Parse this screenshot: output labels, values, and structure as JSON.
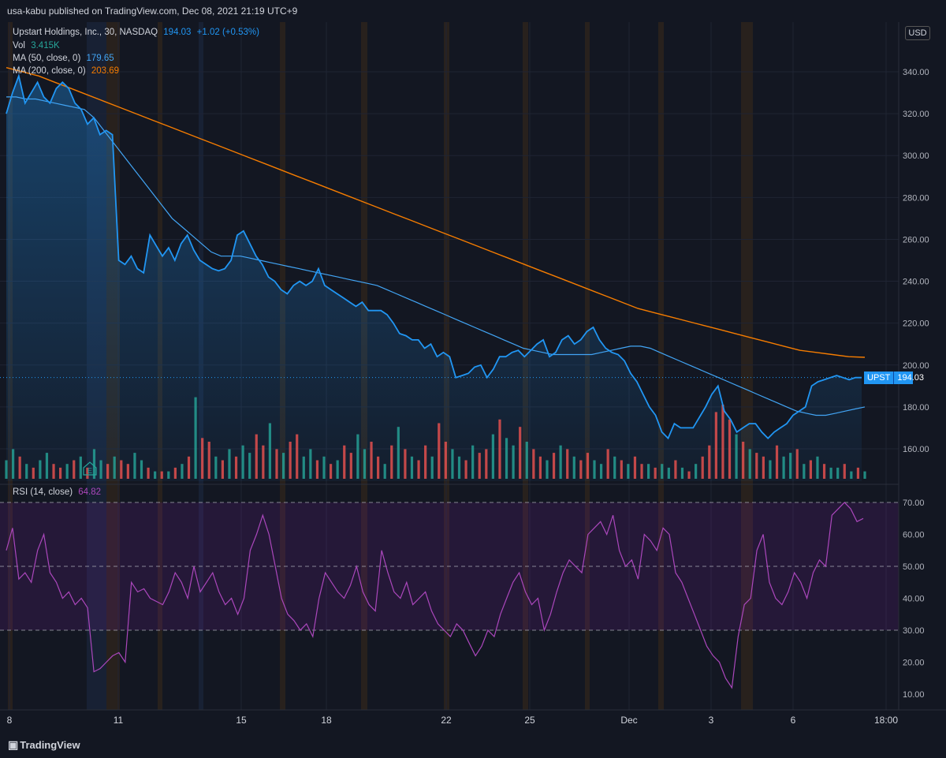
{
  "header": {
    "published": "usa-kabu published on TradingView.com, Dec 08, 2021 21:19 UTC+9"
  },
  "legend": {
    "symbol": "Upstart Holdings, Inc., 30, NASDAQ",
    "last": "194.03",
    "change": "+1.02 (+0.53%)",
    "vol_label": "Vol",
    "vol_value": "3.415K",
    "ma50_label": "MA (50, close, 0)",
    "ma50_value": "179.65",
    "ma200_label": "MA (200, close, 0)",
    "ma200_value": "203.69",
    "rsi_label": "RSI (14, close)",
    "rsi_value": "64.82"
  },
  "currency": "USD",
  "price_tag": {
    "ticker": "UPST",
    "value": "194.03"
  },
  "earnings_marker": "E",
  "footer": {
    "brand": "TradingView"
  },
  "colors": {
    "price": "#2196f3",
    "ma50": "#42a5f5",
    "ma200": "#f57c00",
    "rsi": "#9c27b0",
    "vol_up": "#26a69a",
    "vol_down": "#ef5350"
  },
  "chart_data": [
    {
      "type": "line",
      "name": "price",
      "x_ticks": [
        "8",
        "11",
        "15",
        "18",
        "22",
        "25",
        "Dec",
        "3",
        "6",
        "18:00"
      ],
      "y_ticks": [
        "340.00",
        "320.00",
        "300.00",
        "280.00",
        "260.00",
        "240.00",
        "220.00",
        "200.00",
        "180.00",
        "160.00"
      ],
      "ylim": [
        145,
        345
      ],
      "series": [
        {
          "name": "Upstart Holdings, Inc.",
          "values": [
            320,
            330,
            338,
            325,
            330,
            335,
            328,
            325,
            332,
            335,
            332,
            325,
            322,
            315,
            318,
            310,
            312,
            310,
            250,
            248,
            252,
            246,
            244,
            262,
            257,
            252,
            256,
            250,
            258,
            262,
            255,
            250,
            248,
            246,
            245,
            246,
            250,
            262,
            264,
            258,
            252,
            248,
            242,
            240,
            236,
            234,
            238,
            240,
            238,
            240,
            246,
            238,
            236,
            234,
            232,
            230,
            228,
            230,
            226,
            226,
            226,
            224,
            220,
            215,
            214,
            212,
            212,
            208,
            210,
            204,
            206,
            204,
            194,
            195,
            196,
            199,
            200,
            194,
            198,
            204,
            204,
            206,
            207,
            204,
            207,
            210,
            212,
            204,
            206,
            212,
            214,
            210,
            212,
            216,
            218,
            212,
            208,
            206,
            205,
            202,
            196,
            192,
            186,
            180,
            176,
            168,
            165,
            172,
            170,
            170,
            170,
            175,
            180,
            186,
            190,
            178,
            174,
            168,
            170,
            172,
            172,
            168,
            165,
            168,
            170,
            172,
            176,
            178,
            180,
            190,
            192,
            193,
            194,
            195,
            194,
            193,
            194,
            194
          ]
        },
        {
          "name": "MA (50, close, 0)",
          "values": [
            328,
            328,
            327,
            327,
            326,
            325,
            324,
            323,
            322,
            318,
            312,
            306,
            300,
            294,
            288,
            282,
            276,
            270,
            266,
            262,
            258,
            254,
            252,
            252,
            252,
            251,
            250,
            249,
            248,
            247,
            246,
            245,
            244,
            243,
            242,
            241,
            240,
            239,
            238,
            236,
            234,
            232,
            230,
            228,
            226,
            224,
            222,
            220,
            218,
            216,
            214,
            212,
            210,
            208,
            207,
            206,
            205,
            205,
            205,
            205,
            205,
            206,
            207,
            208,
            209,
            209,
            208,
            206,
            204,
            202,
            200,
            198,
            196,
            194,
            192,
            190,
            188,
            186,
            184,
            182,
            180,
            178,
            177,
            176,
            176,
            177,
            178,
            179,
            180
          ]
        },
        {
          "name": "MA (200, close, 0)",
          "values": [
            342,
            340,
            338,
            335,
            332,
            329,
            326,
            323,
            320,
            317,
            314,
            311,
            308,
            305,
            302,
            299,
            296,
            293,
            290,
            287,
            284,
            281,
            278,
            275,
            272,
            269,
            266,
            263,
            260,
            257,
            254,
            251,
            248,
            245,
            242,
            239,
            236,
            233,
            230,
            227,
            225,
            223,
            221,
            219,
            217,
            215,
            213,
            211,
            209,
            207,
            206,
            205,
            204,
            203.69
          ]
        }
      ]
    },
    {
      "type": "bar",
      "name": "volume",
      "values": [
        5,
        8,
        6,
        4,
        3,
        5,
        7,
        4,
        3,
        4,
        5,
        6,
        3,
        8,
        5,
        4,
        6,
        5,
        4,
        7,
        5,
        3,
        2,
        2,
        2,
        3,
        4,
        6,
        22,
        11,
        10,
        6,
        5,
        8,
        6,
        9,
        7,
        12,
        9,
        15,
        8,
        7,
        10,
        12,
        6,
        8,
        5,
        6,
        4,
        5,
        9,
        7,
        12,
        8,
        10,
        6,
        4,
        9,
        14,
        8,
        6,
        5,
        9,
        6,
        15,
        10,
        8,
        6,
        5,
        9,
        7,
        8,
        12,
        16,
        11,
        9,
        14,
        10,
        8,
        6,
        5,
        7,
        9,
        8,
        6,
        5,
        7,
        5,
        4,
        8,
        6,
        5,
        4,
        6,
        4,
        4,
        3,
        4,
        3,
        5,
        3,
        2,
        4,
        6,
        9,
        18,
        20,
        16,
        12,
        10,
        8,
        7,
        6,
        5,
        9,
        6,
        7,
        8,
        4,
        5,
        6,
        4,
        3,
        3,
        4,
        2,
        3,
        2
      ],
      "colors_up": [
        1,
        1,
        0,
        1,
        0,
        1,
        1,
        0,
        0,
        1,
        0,
        1,
        0,
        1,
        1,
        0,
        1,
        0,
        0,
        1,
        1,
        0,
        1,
        0,
        1,
        0,
        1,
        0,
        1,
        0,
        0,
        1,
        0,
        1,
        0,
        1,
        1,
        0,
        0,
        1,
        0,
        1,
        0,
        0,
        1,
        1,
        0,
        1,
        0,
        1,
        0,
        0,
        1,
        1,
        0,
        0,
        1,
        0,
        1,
        0,
        1,
        0,
        0,
        1,
        0,
        0,
        1,
        1,
        0,
        1,
        0,
        0,
        1,
        0,
        1,
        1,
        0,
        1,
        0,
        0,
        1,
        0,
        1,
        0,
        1,
        0,
        0,
        1,
        1,
        0,
        1,
        0,
        1,
        0,
        0,
        1,
        0,
        1,
        1,
        0,
        1,
        0,
        1,
        0,
        0,
        0,
        0,
        0,
        1,
        0,
        1,
        0,
        0,
        1,
        0,
        1,
        1,
        0,
        1,
        0,
        1,
        0,
        1,
        1,
        0,
        1,
        0,
        1
      ]
    },
    {
      "type": "line",
      "name": "RSI (14, close)",
      "y_ticks": [
        "70.00",
        "60.00",
        "50.00",
        "40.00",
        "30.00",
        "20.00",
        "10.00"
      ],
      "ylim": [
        5,
        75
      ],
      "bands": [
        30,
        50,
        70
      ],
      "values": [
        55,
        62,
        46,
        48,
        45,
        55,
        60,
        48,
        45,
        40,
        42,
        38,
        40,
        37,
        17,
        18,
        20,
        22,
        23,
        20,
        45,
        42,
        43,
        40,
        39,
        38,
        42,
        48,
        45,
        40,
        50,
        42,
        45,
        48,
        42,
        38,
        40,
        35,
        40,
        55,
        60,
        66,
        60,
        50,
        40,
        35,
        33,
        30,
        32,
        28,
        40,
        48,
        45,
        42,
        40,
        44,
        50,
        42,
        38,
        36,
        55,
        48,
        42,
        40,
        45,
        38,
        40,
        42,
        36,
        32,
        30,
        28,
        32,
        30,
        26,
        22,
        25,
        30,
        28,
        35,
        40,
        45,
        48,
        42,
        38,
        40,
        30,
        35,
        42,
        48,
        52,
        50,
        48,
        60,
        62,
        64,
        60,
        66,
        55,
        50,
        52,
        46,
        60,
        58,
        55,
        62,
        60,
        48,
        45,
        40,
        35,
        30,
        25,
        22,
        20,
        15,
        12,
        28,
        38,
        40,
        55,
        60,
        45,
        40,
        38,
        42,
        48,
        45,
        40,
        48,
        52,
        50,
        66,
        68,
        70,
        68,
        64,
        65
      ]
    }
  ]
}
